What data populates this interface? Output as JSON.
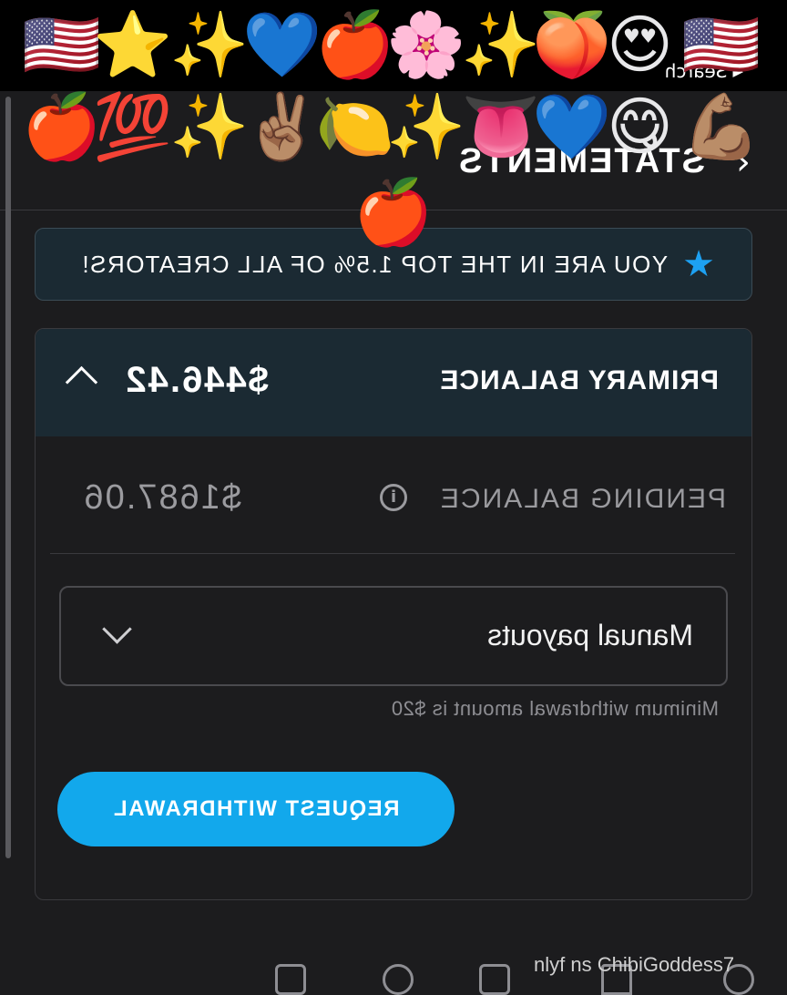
{
  "status_bar": {
    "back_label": "Search"
  },
  "header": {
    "title": "STATEMENTS"
  },
  "banner": {
    "text": "YOU ARE IN THE TOP 1.5% OF ALL CREATORS!"
  },
  "balances": {
    "primary_label": "PRIMARY BALANCE",
    "primary_amount": "$446.42",
    "pending_label": "PENDING BALANCE",
    "pending_amount": "$1687.06"
  },
  "payout": {
    "selected": "Manual payouts",
    "hint": "Minimum withdrawal amount is $20",
    "button_label": "REQUEST WITHDRAWAL"
  },
  "watermark": "nlyf ns ChibiGoddess7",
  "colors": {
    "accent": "#12a8ec",
    "banner_bg": "#1b2a33",
    "bg": "#1c1c1e"
  },
  "stickers": {
    "row1": [
      "🇺🇸",
      "⭐",
      "✨",
      "💙",
      "🍎",
      "🌸",
      "✨",
      "🍑",
      "😍",
      "🇺🇸"
    ],
    "row2": [
      "🍎",
      "💯",
      "✨",
      "✌🏽",
      "🍋",
      "✨",
      "👅",
      "💙",
      "😋",
      "💪🏽"
    ],
    "extra": "🍎"
  }
}
